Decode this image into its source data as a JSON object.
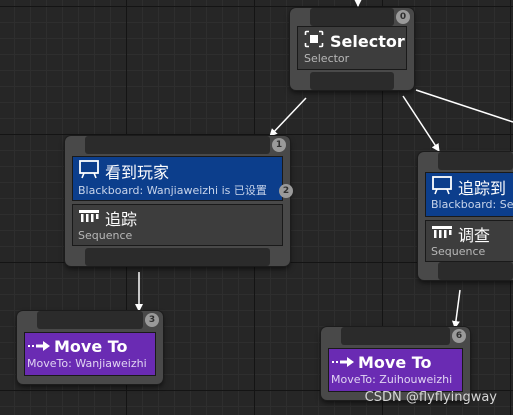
{
  "nodes": {
    "selector": {
      "title": "Selector",
      "subtitle": "Selector",
      "index": "0"
    },
    "root_left": {
      "index": "1",
      "decorator": {
        "title": "看到玩家",
        "subtitle": "Blackboard: Wanjiaweizhi is 已设置",
        "index": "2"
      },
      "composite": {
        "title": "追踪",
        "subtitle": "Sequence"
      }
    },
    "move_left": {
      "title": "Move To",
      "subtitle": "MoveTo: Wanjiaweizhi",
      "index": "3"
    },
    "root_right": {
      "decorator": {
        "title": "追踪到",
        "subtitle": "Blackboard: Se"
      },
      "composite": {
        "title": "调查",
        "subtitle": "Sequence"
      }
    },
    "move_right": {
      "title": "Move To",
      "subtitle": "MoveTo: Zuihouweizhi",
      "index": "6"
    }
  },
  "watermark": "CSDN @flyflyingway",
  "colors": {
    "canvas": "#262626",
    "node": "#494949",
    "decorator": "#0c3e8c",
    "task": "#6a2bb3",
    "wire": "#ffffff"
  },
  "icons": [
    "selector-icon",
    "blackboard-icon",
    "sequence-icon",
    "moveto-icon"
  ]
}
